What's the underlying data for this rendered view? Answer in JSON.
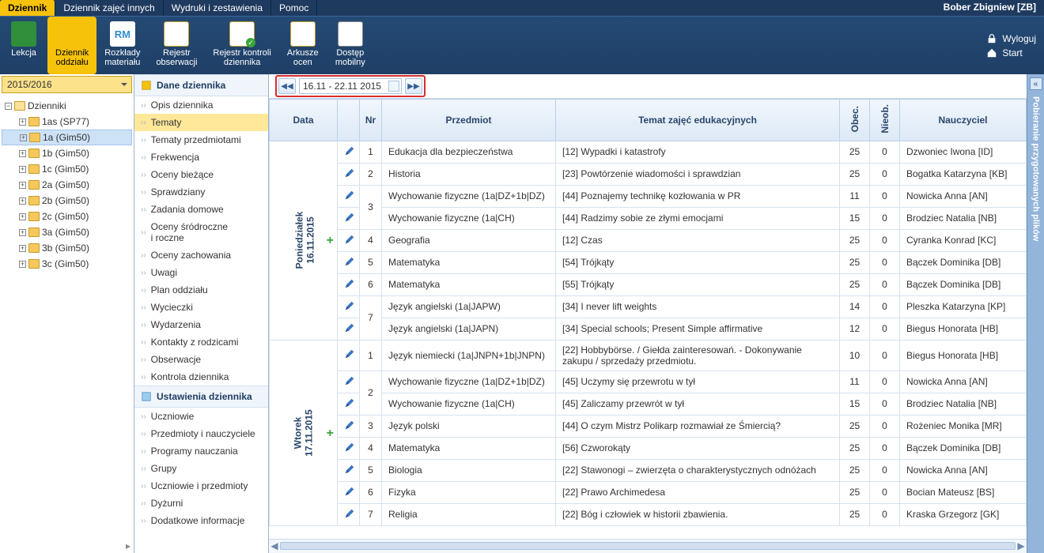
{
  "tabs": {
    "items": [
      "Dziennik",
      "Dziennik zajęć innych",
      "Wydruki i zestawienia",
      "Pomoc"
    ],
    "active": 0
  },
  "user": "Bober Zbigniew [ZB]",
  "header_links": {
    "logout": "Wyloguj",
    "start": "Start"
  },
  "ribbon": [
    {
      "key": "lekcja",
      "label": "Lekcja"
    },
    {
      "key": "dziennik-oddzialu",
      "label": "Dziennik\noddziału",
      "active": true
    },
    {
      "key": "rozklady",
      "label": "Rozkłady\nmateriału"
    },
    {
      "key": "rejestr-obs",
      "label": "Rejestr\nobserwacji"
    },
    {
      "key": "rejestr-kontroli",
      "label": "Rejestr kontroli\ndziennika"
    },
    {
      "key": "arkusze",
      "label": "Arkusze\nocen"
    },
    {
      "key": "mobilny",
      "label": "Dostęp\nmobilny"
    }
  ],
  "year": "2015/2016",
  "tree": {
    "root": "Dzienniki",
    "children": [
      {
        "label": "1as (SP77)"
      },
      {
        "label": "1a (Gim50)",
        "selected": true
      },
      {
        "label": "1b (Gim50)"
      },
      {
        "label": "1c (Gim50)"
      },
      {
        "label": "2a (Gim50)"
      },
      {
        "label": "2b (Gim50)"
      },
      {
        "label": "2c (Gim50)"
      },
      {
        "label": "3a (Gim50)"
      },
      {
        "label": "3b (Gim50)"
      },
      {
        "label": "3c (Gim50)"
      }
    ]
  },
  "sections": {
    "dane": {
      "title": "Dane dziennika",
      "items": [
        "Opis dziennika",
        "Tematy",
        "Tematy przedmiotami",
        "Frekwencja",
        "Oceny bieżące",
        "Sprawdziany",
        "Zadania domowe",
        "Oceny śródroczne\ni roczne",
        "Oceny zachowania",
        "Uwagi",
        "Plan oddziału",
        "Wycieczki",
        "Wydarzenia",
        "Kontakty z rodzicami",
        "Obserwacje",
        "Kontrola dziennika"
      ],
      "active": 1
    },
    "ustawienia": {
      "title": "Ustawienia dziennika",
      "items": [
        "Uczniowie",
        "Przedmioty i nauczyciele",
        "Programy nauczania",
        "Grupy",
        "Uczniowie i przedmioty",
        "Dyżurni",
        "Dodatkowe informacje"
      ]
    }
  },
  "date_range": "16.11 - 22.11 2015",
  "columns": {
    "data": "Data",
    "nr": "Nr",
    "przedmiot": "Przedmiot",
    "temat": "Temat zajęć edukacyjnych",
    "obec": "Obec.",
    "nieob": "Nieob.",
    "nauczyciel": "Nauczyciel"
  },
  "days": [
    {
      "label": "Poniedziałek\n16.11.2015",
      "rows": [
        {
          "nr": "1",
          "przedmiot": "Edukacja dla bezpieczeństwa",
          "temat": "[12] Wypadki i katastrofy",
          "obec": "25",
          "nieob": "0",
          "n": "Dzwoniec Iwona [ID]"
        },
        {
          "nr": "2",
          "przedmiot": "Historia",
          "temat": "[23] Powtórzenie wiadomości i sprawdzian",
          "obec": "25",
          "nieob": "0",
          "n": "Bogatka Katarzyna [KB]"
        },
        {
          "nr": "3",
          "span": 2,
          "przedmiot": "Wychowanie fizyczne (1a|DZ+1b|DZ)",
          "temat": "[44] Poznajemy technikę kozłowania w PR",
          "obec": "11",
          "nieob": "0",
          "n": "Nowicka Anna [AN]"
        },
        {
          "przedmiot": "Wychowanie fizyczne (1a|CH)",
          "temat": "[44] Radzimy sobie ze złymi emocjami",
          "obec": "15",
          "nieob": "0",
          "n": "Brodziec Natalia [NB]"
        },
        {
          "nr": "4",
          "przedmiot": "Geografia",
          "temat": "[12] Czas",
          "obec": "25",
          "nieob": "0",
          "n": "Cyranka Konrad [KC]"
        },
        {
          "nr": "5",
          "przedmiot": "Matematyka",
          "temat": "[54] Trójkąty",
          "obec": "25",
          "nieob": "0",
          "n": "Bączek Dominika [DB]"
        },
        {
          "nr": "6",
          "przedmiot": "Matematyka",
          "temat": "[55] Trójkąty",
          "obec": "25",
          "nieob": "0",
          "n": "Bączek Dominika [DB]"
        },
        {
          "nr": "7",
          "span": 2,
          "przedmiot": "Język angielski (1a|JAPW)",
          "temat": "[34] I never lift weights",
          "obec": "14",
          "nieob": "0",
          "n": "Pleszka Katarzyna [KP]"
        },
        {
          "przedmiot": "Język angielski (1a|JAPN)",
          "temat": "[34] Special schools; Present Simple affirmative",
          "obec": "12",
          "nieob": "0",
          "n": "Biegus Honorata [HB]"
        }
      ]
    },
    {
      "label": "Wtorek\n17.11.2015",
      "rows": [
        {
          "nr": "1",
          "przedmiot": "Język niemiecki (1a|JNPN+1b|JNPN)",
          "temat": "[22] Hobbybörse. / Giełda zainteresowań. - Dokonywanie zakupu / sprzedaży przedmiotu.",
          "obec": "10",
          "nieob": "0",
          "n": "Biegus Honorata [HB]"
        },
        {
          "nr": "2",
          "span": 2,
          "przedmiot": "Wychowanie fizyczne (1a|DZ+1b|DZ)",
          "temat": "[45] Uczymy się przewrotu w tył",
          "obec": "11",
          "nieob": "0",
          "n": "Nowicka Anna [AN]"
        },
        {
          "przedmiot": "Wychowanie fizyczne (1a|CH)",
          "temat": "[45] Zaliczamy przewrót w tył",
          "obec": "15",
          "nieob": "0",
          "n": "Brodziec Natalia [NB]"
        },
        {
          "nr": "3",
          "przedmiot": "Język polski",
          "temat": "[44] O czym Mistrz Polikarp rozmawiał ze Śmiercią?",
          "obec": "25",
          "nieob": "0",
          "n": "Rożeniec Monika [MR]"
        },
        {
          "nr": "4",
          "przedmiot": "Matematyka",
          "temat": "[56] Czworokąty",
          "obec": "25",
          "nieob": "0",
          "n": "Bączek Dominika [DB]"
        },
        {
          "nr": "5",
          "przedmiot": "Biologia",
          "temat": "[22] Stawonogi – zwierzęta o charakterystycznych odnóżach",
          "obec": "25",
          "nieob": "0",
          "n": "Nowicka Anna [AN]"
        },
        {
          "nr": "6",
          "przedmiot": "Fizyka",
          "temat": "[22] Prawo Archimedesa",
          "obec": "25",
          "nieob": "0",
          "n": "Bocian Mateusz [BS]"
        },
        {
          "nr": "7",
          "przedmiot": "Religia",
          "temat": "[22] Bóg i człowiek w historii zbawienia.",
          "obec": "25",
          "nieob": "0",
          "n": "Kraska Grzegorz [GK]"
        }
      ]
    }
  ],
  "right_panel": "Pobieranie przygotowanych plików"
}
